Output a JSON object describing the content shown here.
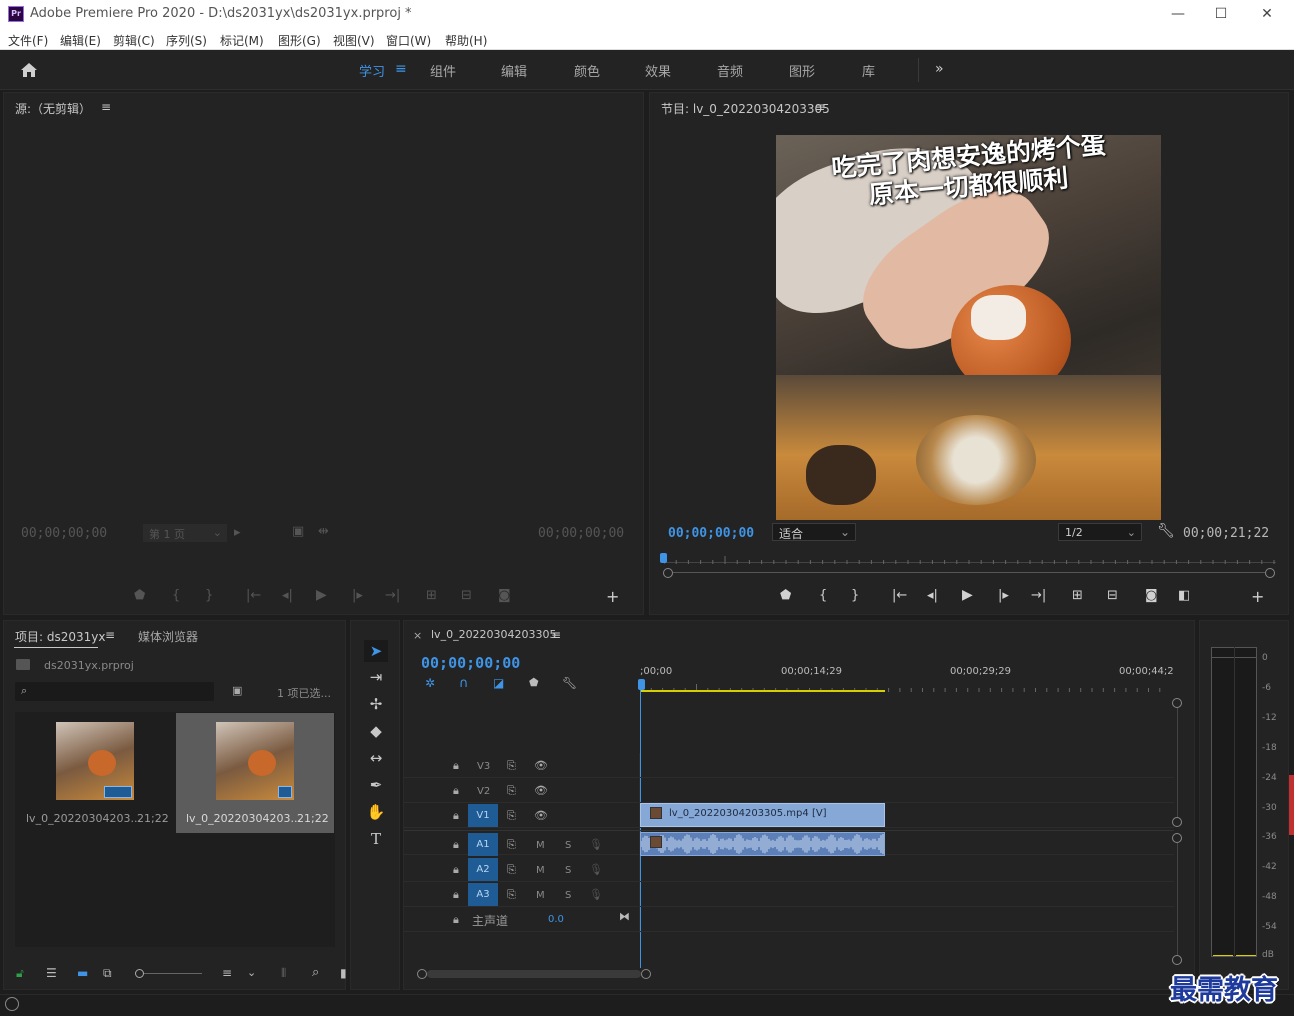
{
  "app": {
    "title": "Adobe Premiere Pro 2020 - D:\\ds2031yx\\ds2031yx.prproj *",
    "logo": "Pr"
  },
  "window_controls": {
    "minimize": "—",
    "maximize": "☐",
    "close": "✕"
  },
  "menu": [
    "文件(F)",
    "编辑(E)",
    "剪辑(C)",
    "序列(S)",
    "标记(M)",
    "图形(G)",
    "视图(V)",
    "窗口(W)",
    "帮助(H)"
  ],
  "workspaces": {
    "items": [
      "学习",
      "组件",
      "编辑",
      "颜色",
      "效果",
      "音频",
      "图形",
      "库"
    ],
    "active": "学习",
    "more": "»"
  },
  "source": {
    "title": "源:（无剪辑）",
    "tc_left": "00;00;00;00",
    "page": "第 1 页",
    "tc_right": "00;00;00;00"
  },
  "program": {
    "title": "节目: lv_0_20220304203305",
    "tc_left": "00;00;00;00",
    "fit": "适合",
    "resolution": "1/2",
    "tc_right": "00;00;21;22",
    "caption_line1": "吃完了肉想安逸的烤个蛋",
    "caption_line2": "原本一切都很顺利"
  },
  "project": {
    "tab_project": "项目: ds2031yx",
    "tab_media": "媒体浏览器",
    "file": "ds2031yx.prproj",
    "selected": "1 项已选...",
    "items": [
      {
        "name": "lv_0_20220304203...",
        "duration": "21;22"
      },
      {
        "name": "lv_0_20220304203...",
        "duration": "21;22"
      }
    ]
  },
  "timeline": {
    "close": "×",
    "sequence": "lv_0_20220304203305",
    "tc": "00;00;00;00",
    "ruler": [
      ";00;00",
      "00;00;14;29",
      "00;00;29;29",
      "00;00;44;2"
    ],
    "tracks": {
      "v3": "V3",
      "v2": "V2",
      "v1": "V1",
      "a1": "A1",
      "a2": "A2",
      "a3": "A3",
      "m": "M",
      "s": "S",
      "master": "主声道",
      "master_val": "0.0"
    },
    "clip": "lv_0_20220304203305.mp4 [V]"
  },
  "meter": {
    "labels": [
      "0",
      "-6",
      "-12",
      "-18",
      "-24",
      "-30",
      "-36",
      "-42",
      "-48",
      "-54",
      "dB"
    ]
  },
  "watermark": "最需教育"
}
